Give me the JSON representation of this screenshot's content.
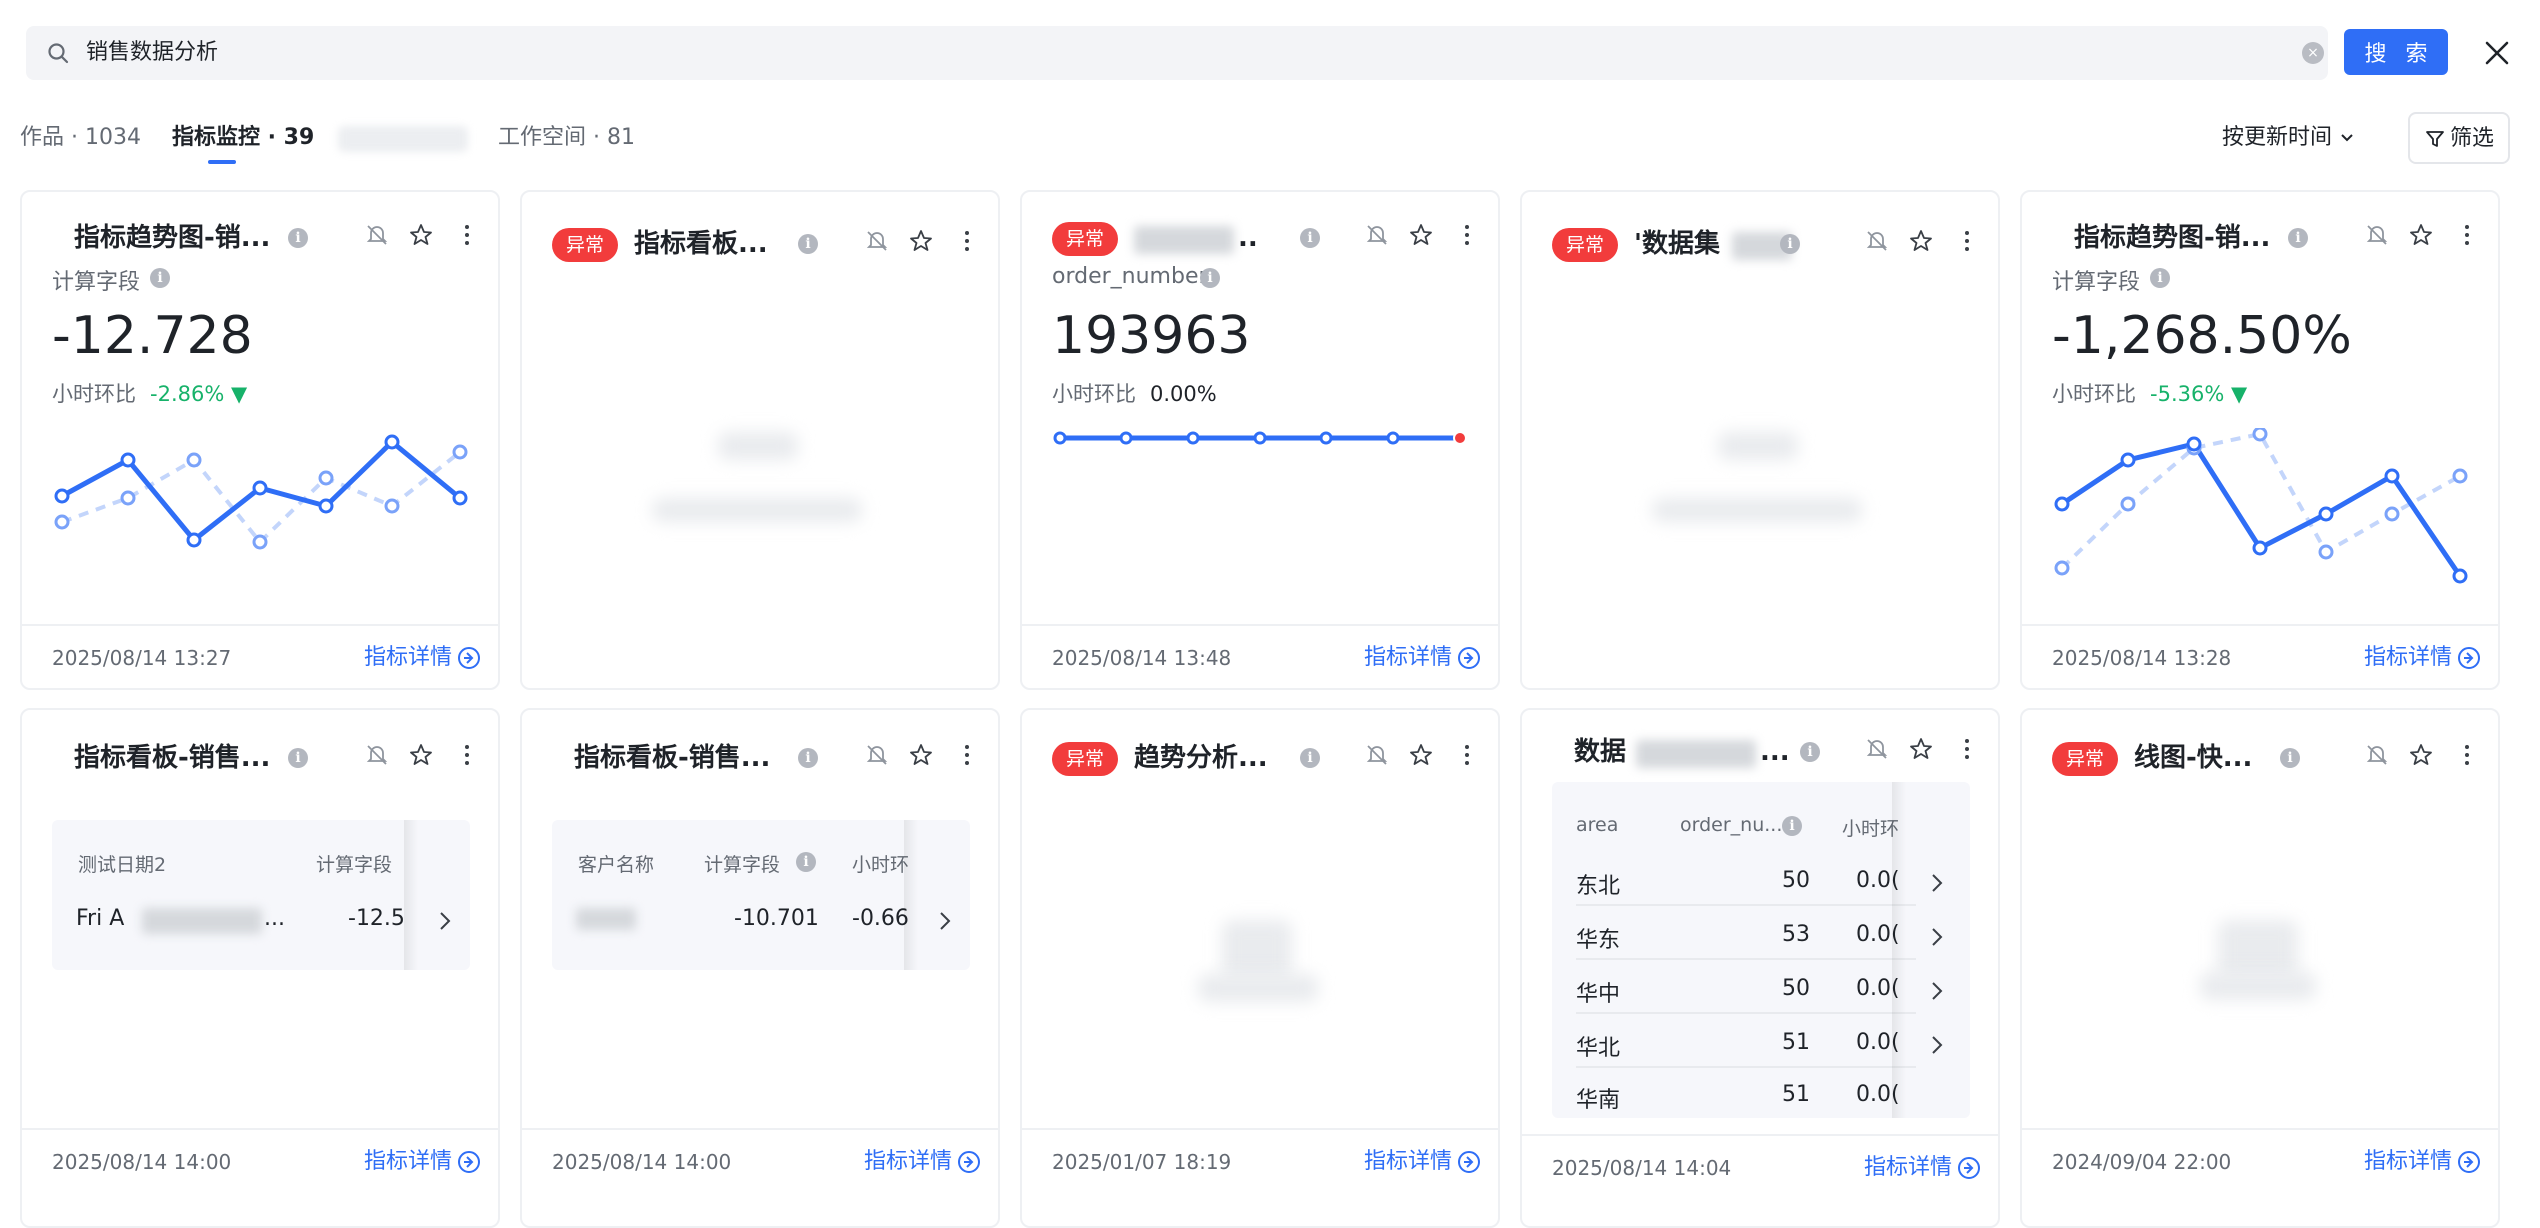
{
  "search": {
    "query": "销售数据分析",
    "button_label": "搜 索"
  },
  "tabs": [
    {
      "label": "作品 · 1034"
    },
    {
      "label": "指标监控 · 39"
    },
    {
      "label": "工作空间 · 81"
    }
  ],
  "sort": {
    "label": "按更新时间"
  },
  "filter": {
    "label": "筛选"
  },
  "icons": [
    "search-icon",
    "clear-icon",
    "close-icon",
    "chevron-down-icon",
    "filter-icon",
    "info-icon",
    "mute-bell-icon",
    "star-icon",
    "more-vertical-icon",
    "arrow-circle-right-icon",
    "chevron-right-icon"
  ],
  "colors": {
    "accent": "#2f6ef6",
    "alert": "#f23c3c",
    "up": "#17b26a"
  },
  "cards": [
    {
      "title": "指标趋势图-销...",
      "field_label": "计算字段",
      "value": "-12.728",
      "compare_label": "小时环比",
      "compare_value": "-2.86%",
      "compare_arrow": "▼",
      "date": "2025/08/14 13:27",
      "detail_label": "指标详情"
    },
    {
      "badge": "异常",
      "title": "指标看板..."
    },
    {
      "badge": "异常",
      "title": "..",
      "field_label": "order_number",
      "value": "193963",
      "compare_label": "小时环比",
      "compare_value": "0.00%",
      "date": "2025/08/14 13:48",
      "detail_label": "指标详情"
    },
    {
      "badge": "异常",
      "title": "'数据集"
    },
    {
      "title": "指标趋势图-销...",
      "field_label": "计算字段",
      "value": "-1,268.50%",
      "compare_label": "小时环比",
      "compare_value": "-5.36%",
      "compare_arrow": "▼",
      "date": "2025/08/14 13:28",
      "detail_label": "指标详情"
    },
    {
      "title": "指标看板-销售...",
      "columns": [
        "测试日期2",
        "计算字段"
      ],
      "rows": [
        [
          "Fri A",
          "..."
        ]
      ],
      "value_cells": [
        "-12.5"
      ],
      "date": "2025/08/14 14:00",
      "detail_label": "指标详情"
    },
    {
      "title": "指标看板-销售...",
      "columns": [
        "客户名称",
        "计算字段",
        "小时环"
      ],
      "rows": [
        [
          "-10.701",
          "-0.66"
        ]
      ],
      "date": "2025/08/14 14:00",
      "detail_label": "指标详情"
    },
    {
      "badge": "异常",
      "title": "趋势分析...",
      "date": "2025/01/07 18:19",
      "detail_label": "指标详情"
    },
    {
      "title": "数据",
      "title_suffix": "...",
      "columns": [
        "area",
        "order_nu...",
        "小时环"
      ],
      "rows": [
        {
          "area": "东北",
          "order": "50",
          "ratio": "0.0("
        },
        {
          "area": "华东",
          "order": "53",
          "ratio": "0.0("
        },
        {
          "area": "华中",
          "order": "50",
          "ratio": "0.0("
        },
        {
          "area": "华北",
          "order": "51",
          "ratio": "0.0("
        },
        {
          "area": "华南",
          "order": "51",
          "ratio": "0.0("
        }
      ],
      "date": "2025/08/14 14:04",
      "detail_label": "指标详情"
    },
    {
      "badge": "异常",
      "title": "线图-快...",
      "date": "2024/09/04 22:00",
      "detail_label": "指标详情"
    }
  ]
}
